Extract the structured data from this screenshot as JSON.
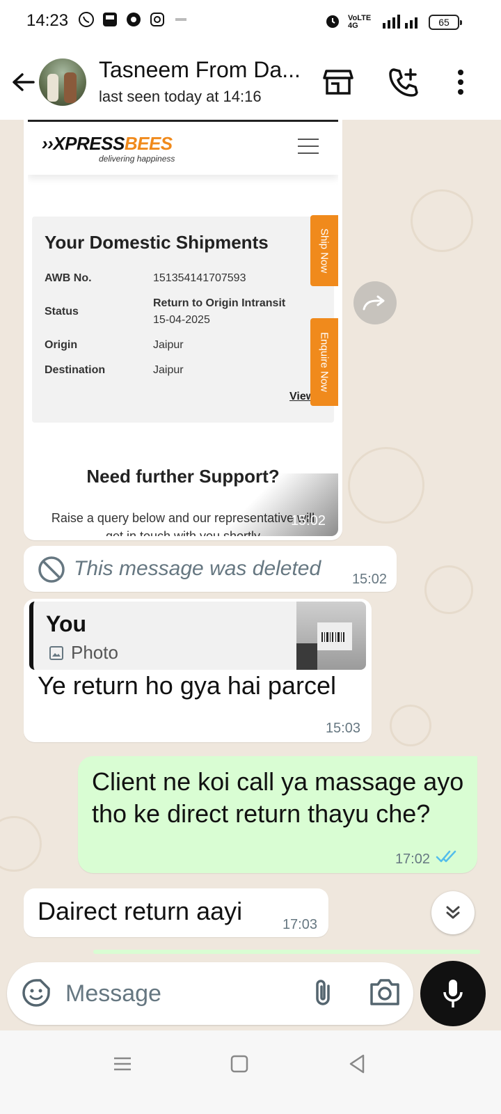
{
  "status_bar": {
    "time": "14:23",
    "network_label": "VoLTE 4G",
    "battery": "65"
  },
  "header": {
    "contact_name": "Tasneem From Da...",
    "last_seen": "last seen today at 14:16"
  },
  "messages": {
    "screenshot": {
      "brand": "XPRESS",
      "brand_accent": "BEES",
      "tagline": "delivering happiness",
      "card_title": "Your Domestic Shipments",
      "awb_label": "AWB No.",
      "awb_value": "151354141707593",
      "status_label": "Status",
      "status_value": "Return to Origin Intransit",
      "status_date": "15-04-2025",
      "origin_label": "Origin",
      "origin_value": "Jaipur",
      "destination_label": "Destination",
      "destination_value": "Jaipur",
      "view_link": "View",
      "ship_now": "Ship Now",
      "enquire_now": "Enquire Now",
      "support_title": "Need further Support?",
      "support_text": "Raise a query below and our representative will get in touch with you shortly",
      "time": "15:02"
    },
    "deleted": {
      "text": "This message was deleted",
      "time": "15:02"
    },
    "reply": {
      "quoted_author": "You",
      "quoted_type": "Photo",
      "text": "Ye return ho gya hai parcel",
      "time": "15:03"
    },
    "outgoing": {
      "text": "Client ne koi call ya massage ayo tho ke direct return thayu che?",
      "time": "17:02"
    },
    "last_incoming": {
      "text": "Dairect return aayi",
      "time": "17:03"
    }
  },
  "composer": {
    "placeholder": "Message"
  },
  "colors": {
    "chat_bg": "#efe7dd",
    "outgoing_bubble": "#d9fdd3",
    "read_ticks": "#53bdeb",
    "brand_orange": "#f08a1c"
  }
}
